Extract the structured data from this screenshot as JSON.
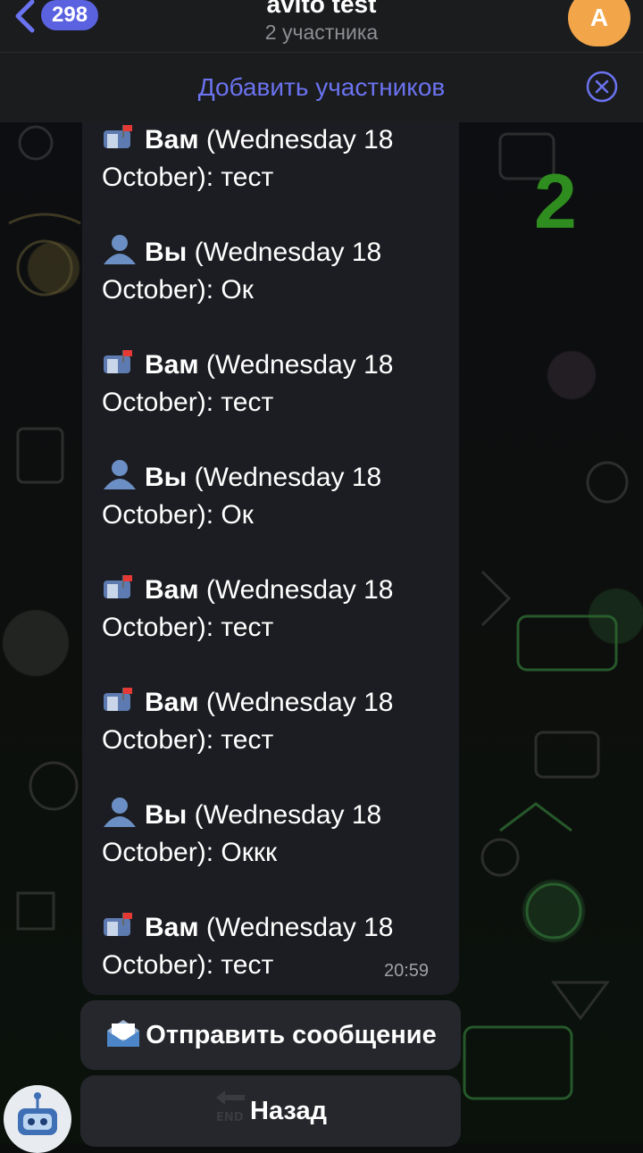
{
  "header": {
    "back_count": "298",
    "title": "avito test",
    "subtitle": "2 участника",
    "avatar_letter": "A",
    "add_members_label": "Добавить участников"
  },
  "annotation": {
    "number": "2",
    "color": "#2f8c1f"
  },
  "messages": [
    {
      "icon": "mailbox-icon",
      "sender": "Вам",
      "date": "(Wednesday 18 October)",
      "text": ": тест"
    },
    {
      "icon": "user-silhouette-icon",
      "sender": "Вы",
      "date": "(Wednesday 18 October)",
      "text": ": Ок"
    },
    {
      "icon": "mailbox-icon",
      "sender": "Вам",
      "date": "(Wednesday 18 October)",
      "text": ": тест"
    },
    {
      "icon": "user-silhouette-icon",
      "sender": "Вы",
      "date": "(Wednesday 18 October)",
      "text": ": Ок"
    },
    {
      "icon": "mailbox-icon",
      "sender": "Вам",
      "date": "(Wednesday 18 October)",
      "text": ": тест"
    },
    {
      "icon": "mailbox-icon",
      "sender": "Вам",
      "date": "(Wednesday 18 October)",
      "text": ": тест"
    },
    {
      "icon": "user-silhouette-icon",
      "sender": "Вы",
      "date": "(Wednesday 18 October)",
      "text": ": Оккк"
    },
    {
      "icon": "mailbox-icon",
      "sender": "Вам",
      "date": "(Wednesday 18 October)",
      "text": ": тест"
    }
  ],
  "message_time": "20:59",
  "keyboard": {
    "send_label": "Отправить сообщение",
    "back_label": "Назад",
    "end_text": "END"
  },
  "colors": {
    "accent": "#6b73f0",
    "badge": "#5a62e0",
    "avatar": "#f3a54a"
  }
}
